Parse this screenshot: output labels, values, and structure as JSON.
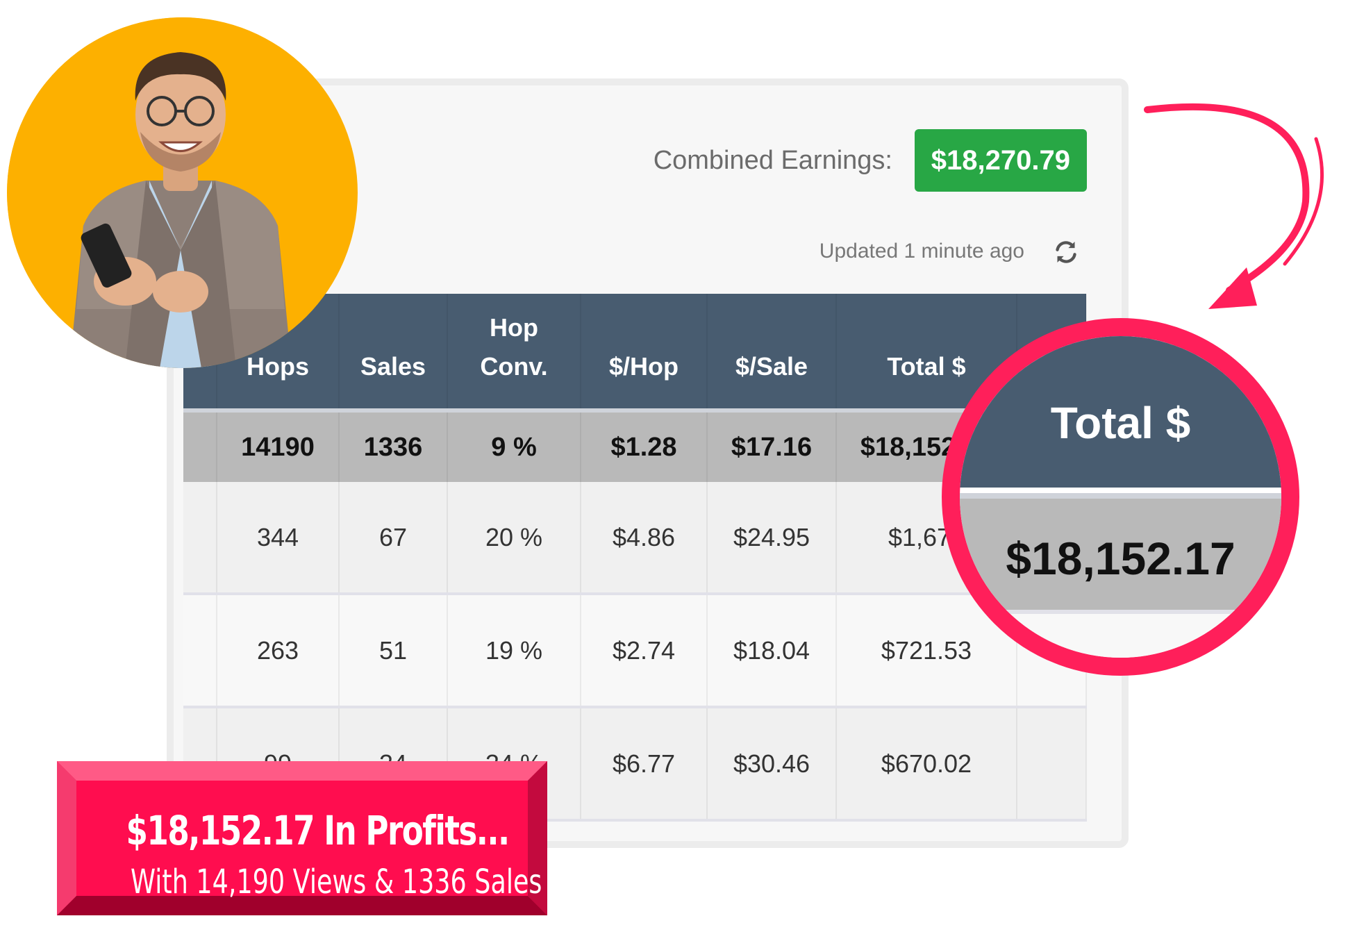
{
  "summary": {
    "earnings_label": "Combined Earnings:",
    "earnings_value": "$18,270.79",
    "updated_text": "Updated 1 minute ago"
  },
  "table": {
    "headers": {
      "hops": "Hops",
      "sales": "Sales",
      "hop_conv_line1": "Hop",
      "hop_conv_line2": "Conv.",
      "per_hop": "$/Hop",
      "per_sale": "$/Sale",
      "total": "Total $"
    },
    "totals": {
      "hops": "14190",
      "sales": "1336",
      "hop_conv": "9 %",
      "per_hop": "$1.28",
      "per_sale": "$17.16",
      "total": "$18,152.17"
    },
    "rows": [
      {
        "hops": "344",
        "sales": "67",
        "hop_conv": "20 %",
        "per_hop": "$4.86",
        "per_sale": "$24.95",
        "total": "$1,671"
      },
      {
        "hops": "263",
        "sales": "51",
        "hop_conv": "19 %",
        "per_hop": "$2.74",
        "per_sale": "$18.04",
        "total": "$721.53"
      },
      {
        "hops": "99",
        "sales": "34",
        "hop_conv": "34 %",
        "per_hop": "$6.77",
        "per_sale": "$30.46",
        "total": "$670.02"
      }
    ]
  },
  "zoom": {
    "header": "Total $",
    "value": "$18,152.17"
  },
  "banner": {
    "title": "$18,152.17 In Profits...",
    "subtitle": "With 14,190 Views & 1336 Sales"
  },
  "colors": {
    "table_header": "#485c70",
    "earnings_badge": "#28a745",
    "accent": "#ff1f5a",
    "avatar_bg": "#fdb000"
  },
  "icons": {
    "refresh": "refresh-icon",
    "arrow": "curved-arrow-icon"
  }
}
